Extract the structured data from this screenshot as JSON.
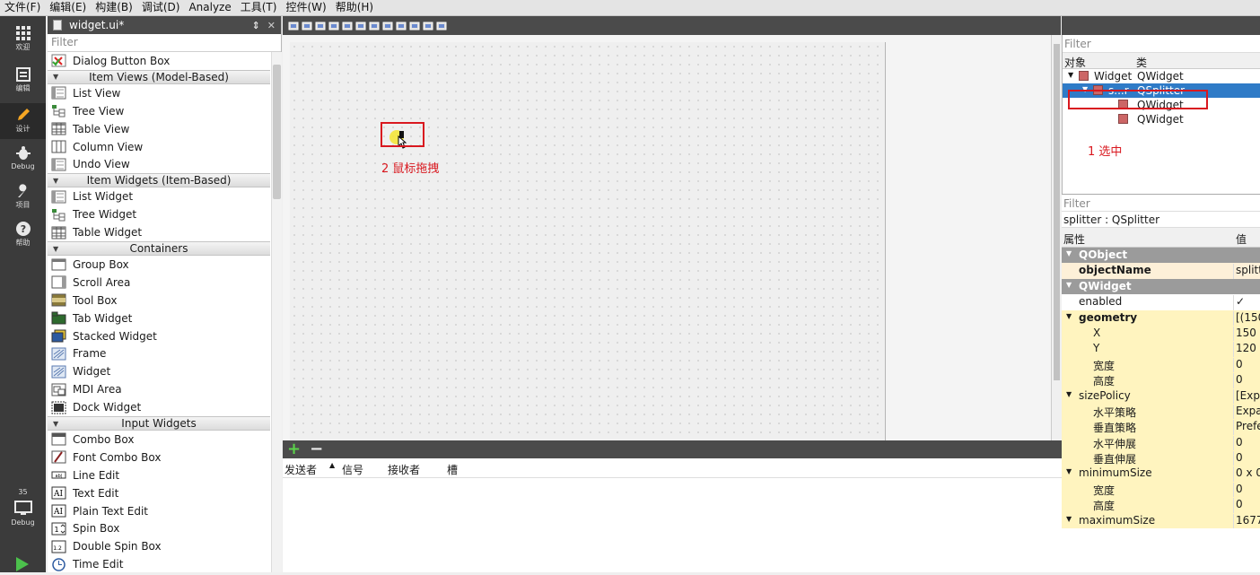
{
  "menubar": [
    "文件(F)",
    "编辑(E)",
    "构建(B)",
    "调试(D)",
    "Analyze",
    "工具(T)",
    "控件(W)",
    "帮助(H)"
  ],
  "modes": [
    {
      "label": "欢迎",
      "icon": "grid-icon"
    },
    {
      "label": "编辑",
      "icon": "edit-doc-icon"
    },
    {
      "label": "设计",
      "icon": "pencil-icon"
    },
    {
      "label": "Debug",
      "icon": "bug-icon"
    },
    {
      "label": "项目",
      "icon": "wrench-icon"
    },
    {
      "label": "帮助",
      "icon": "help-icon"
    }
  ],
  "kit": {
    "number": "35",
    "label": "Debug"
  },
  "file_tab": {
    "name": "widget.ui*",
    "sep": "⇕",
    "close": "✕"
  },
  "left_filter": "Filter",
  "widgetbox": [
    {
      "type": "item",
      "label": "Dialog Button Box",
      "icon": "dialogbtn"
    },
    {
      "type": "cat",
      "label": "Item Views (Model-Based)"
    },
    {
      "type": "item",
      "label": "List View",
      "icon": "list"
    },
    {
      "type": "item",
      "label": "Tree View",
      "icon": "tree"
    },
    {
      "type": "item",
      "label": "Table View",
      "icon": "table"
    },
    {
      "type": "item",
      "label": "Column View",
      "icon": "column"
    },
    {
      "type": "item",
      "label": "Undo View",
      "icon": "list"
    },
    {
      "type": "cat",
      "label": "Item Widgets (Item-Based)"
    },
    {
      "type": "item",
      "label": "List Widget",
      "icon": "list"
    },
    {
      "type": "item",
      "label": "Tree Widget",
      "icon": "tree"
    },
    {
      "type": "item",
      "label": "Table Widget",
      "icon": "table"
    },
    {
      "type": "cat",
      "label": "Containers"
    },
    {
      "type": "item",
      "label": "Group Box",
      "icon": "groupbox"
    },
    {
      "type": "item",
      "label": "Scroll Area",
      "icon": "scroll"
    },
    {
      "type": "item",
      "label": "Tool Box",
      "icon": "toolbox"
    },
    {
      "type": "item",
      "label": "Tab Widget",
      "icon": "tab"
    },
    {
      "type": "item",
      "label": "Stacked Widget",
      "icon": "stacked"
    },
    {
      "type": "item",
      "label": "Frame",
      "icon": "frame"
    },
    {
      "type": "item",
      "label": "Widget",
      "icon": "frame"
    },
    {
      "type": "item",
      "label": "MDI Area",
      "icon": "mdi"
    },
    {
      "type": "item",
      "label": "Dock Widget",
      "icon": "dock"
    },
    {
      "type": "cat",
      "label": "Input Widgets"
    },
    {
      "type": "item",
      "label": "Combo Box",
      "icon": "combo"
    },
    {
      "type": "item",
      "label": "Font Combo Box",
      "icon": "font"
    },
    {
      "type": "item",
      "label": "Line Edit",
      "icon": "lineedit"
    },
    {
      "type": "item",
      "label": "Text Edit",
      "icon": "textedit"
    },
    {
      "type": "item",
      "label": "Plain Text Edit",
      "icon": "textedit"
    },
    {
      "type": "item",
      "label": "Spin Box",
      "icon": "spin"
    },
    {
      "type": "item",
      "label": "Double Spin Box",
      "icon": "dspin"
    },
    {
      "type": "item",
      "label": "Time Edit",
      "icon": "time"
    }
  ],
  "canvas_annotation": "2 鼠标拖拽",
  "sigslot": {
    "add": "+",
    "remove": "−",
    "cols": [
      "发送者",
      "信号",
      "接收者",
      "槽"
    ]
  },
  "object_inspector": {
    "filter": "Filter",
    "headers": [
      "对象",
      "类"
    ],
    "rows": [
      {
        "name": "Widget",
        "class": "QWidget"
      },
      {
        "name": "s...r",
        "class": "QSplitter"
      },
      {
        "name": "",
        "class": "QWidget"
      },
      {
        "name": "",
        "class": "QWidget"
      }
    ],
    "annotation": "1 选中"
  },
  "property_editor": {
    "filter": "Filter",
    "title": "splitter : QSplitter",
    "headers": [
      "属性",
      "值"
    ],
    "rows": [
      {
        "kind": "cat",
        "name": "QObject",
        "value": ""
      },
      {
        "kind": "peach",
        "name": "objectName",
        "value": "splitt",
        "bold": true
      },
      {
        "kind": "cat",
        "name": "QWidget",
        "value": ""
      },
      {
        "kind": "white",
        "name": "enabled",
        "value": "✓"
      },
      {
        "kind": "yellow",
        "name": "geometry",
        "value": "[(150",
        "bold": true,
        "expand": true
      },
      {
        "kind": "yellow",
        "name": "X",
        "value": "150",
        "indent": true
      },
      {
        "kind": "yellow",
        "name": "Y",
        "value": "120",
        "indent": true
      },
      {
        "kind": "yellow",
        "name": "宽度",
        "value": "0",
        "indent": true
      },
      {
        "kind": "yellow",
        "name": "高度",
        "value": "0",
        "indent": true
      },
      {
        "kind": "yellow",
        "name": "sizePolicy",
        "value": "[Expa",
        "expand": true
      },
      {
        "kind": "yellow",
        "name": "水平策略",
        "value": "Expa",
        "indent": true
      },
      {
        "kind": "yellow",
        "name": "垂直策略",
        "value": "Prefe",
        "indent": true
      },
      {
        "kind": "yellow",
        "name": "水平伸展",
        "value": "0",
        "indent": true
      },
      {
        "kind": "yellow",
        "name": "垂直伸展",
        "value": "0",
        "indent": true
      },
      {
        "kind": "yellow",
        "name": "minimumSize",
        "value": "0 x 0",
        "expand": true
      },
      {
        "kind": "yellow",
        "name": "宽度",
        "value": "0",
        "indent": true
      },
      {
        "kind": "yellow",
        "name": "高度",
        "value": "0",
        "indent": true
      },
      {
        "kind": "yellow",
        "name": "maximumSize",
        "value": "1677",
        "expand": true
      }
    ]
  }
}
